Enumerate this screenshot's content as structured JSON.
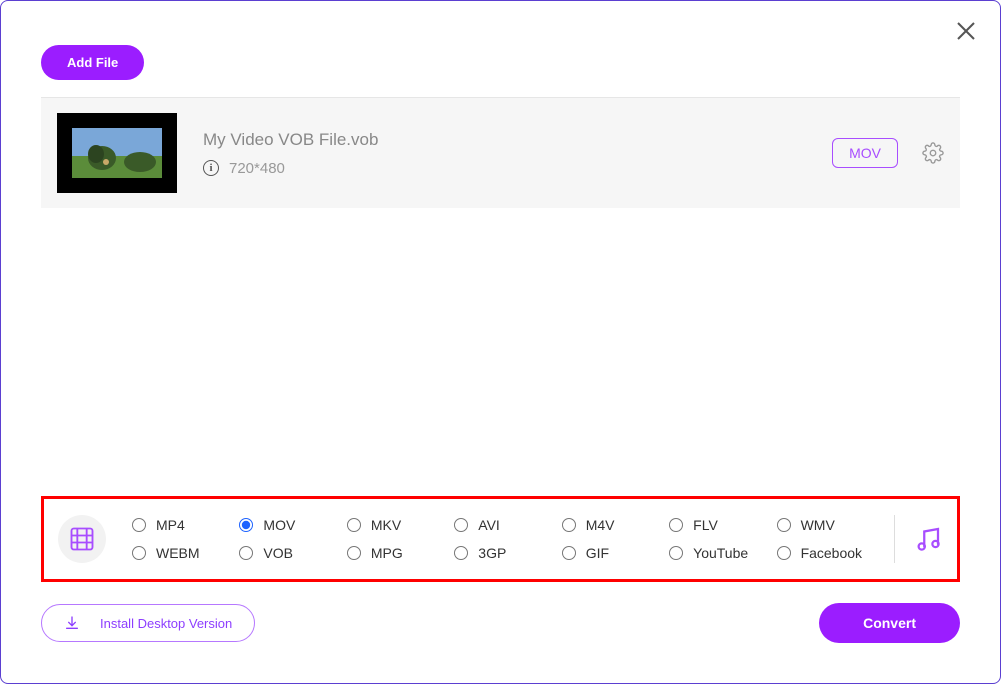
{
  "header": {
    "add_file_label": "Add File"
  },
  "file": {
    "name": "My Video VOB File.vob",
    "dimensions": "720*480",
    "output_format": "MOV"
  },
  "formats": {
    "selected": "MOV",
    "row1": [
      "MP4",
      "MOV",
      "MKV",
      "AVI",
      "M4V",
      "FLV",
      "WMV"
    ],
    "row2": [
      "WEBM",
      "VOB",
      "MPG",
      "3GP",
      "GIF",
      "YouTube",
      "Facebook"
    ]
  },
  "footer": {
    "install_label": "Install Desktop Version",
    "convert_label": "Convert"
  }
}
